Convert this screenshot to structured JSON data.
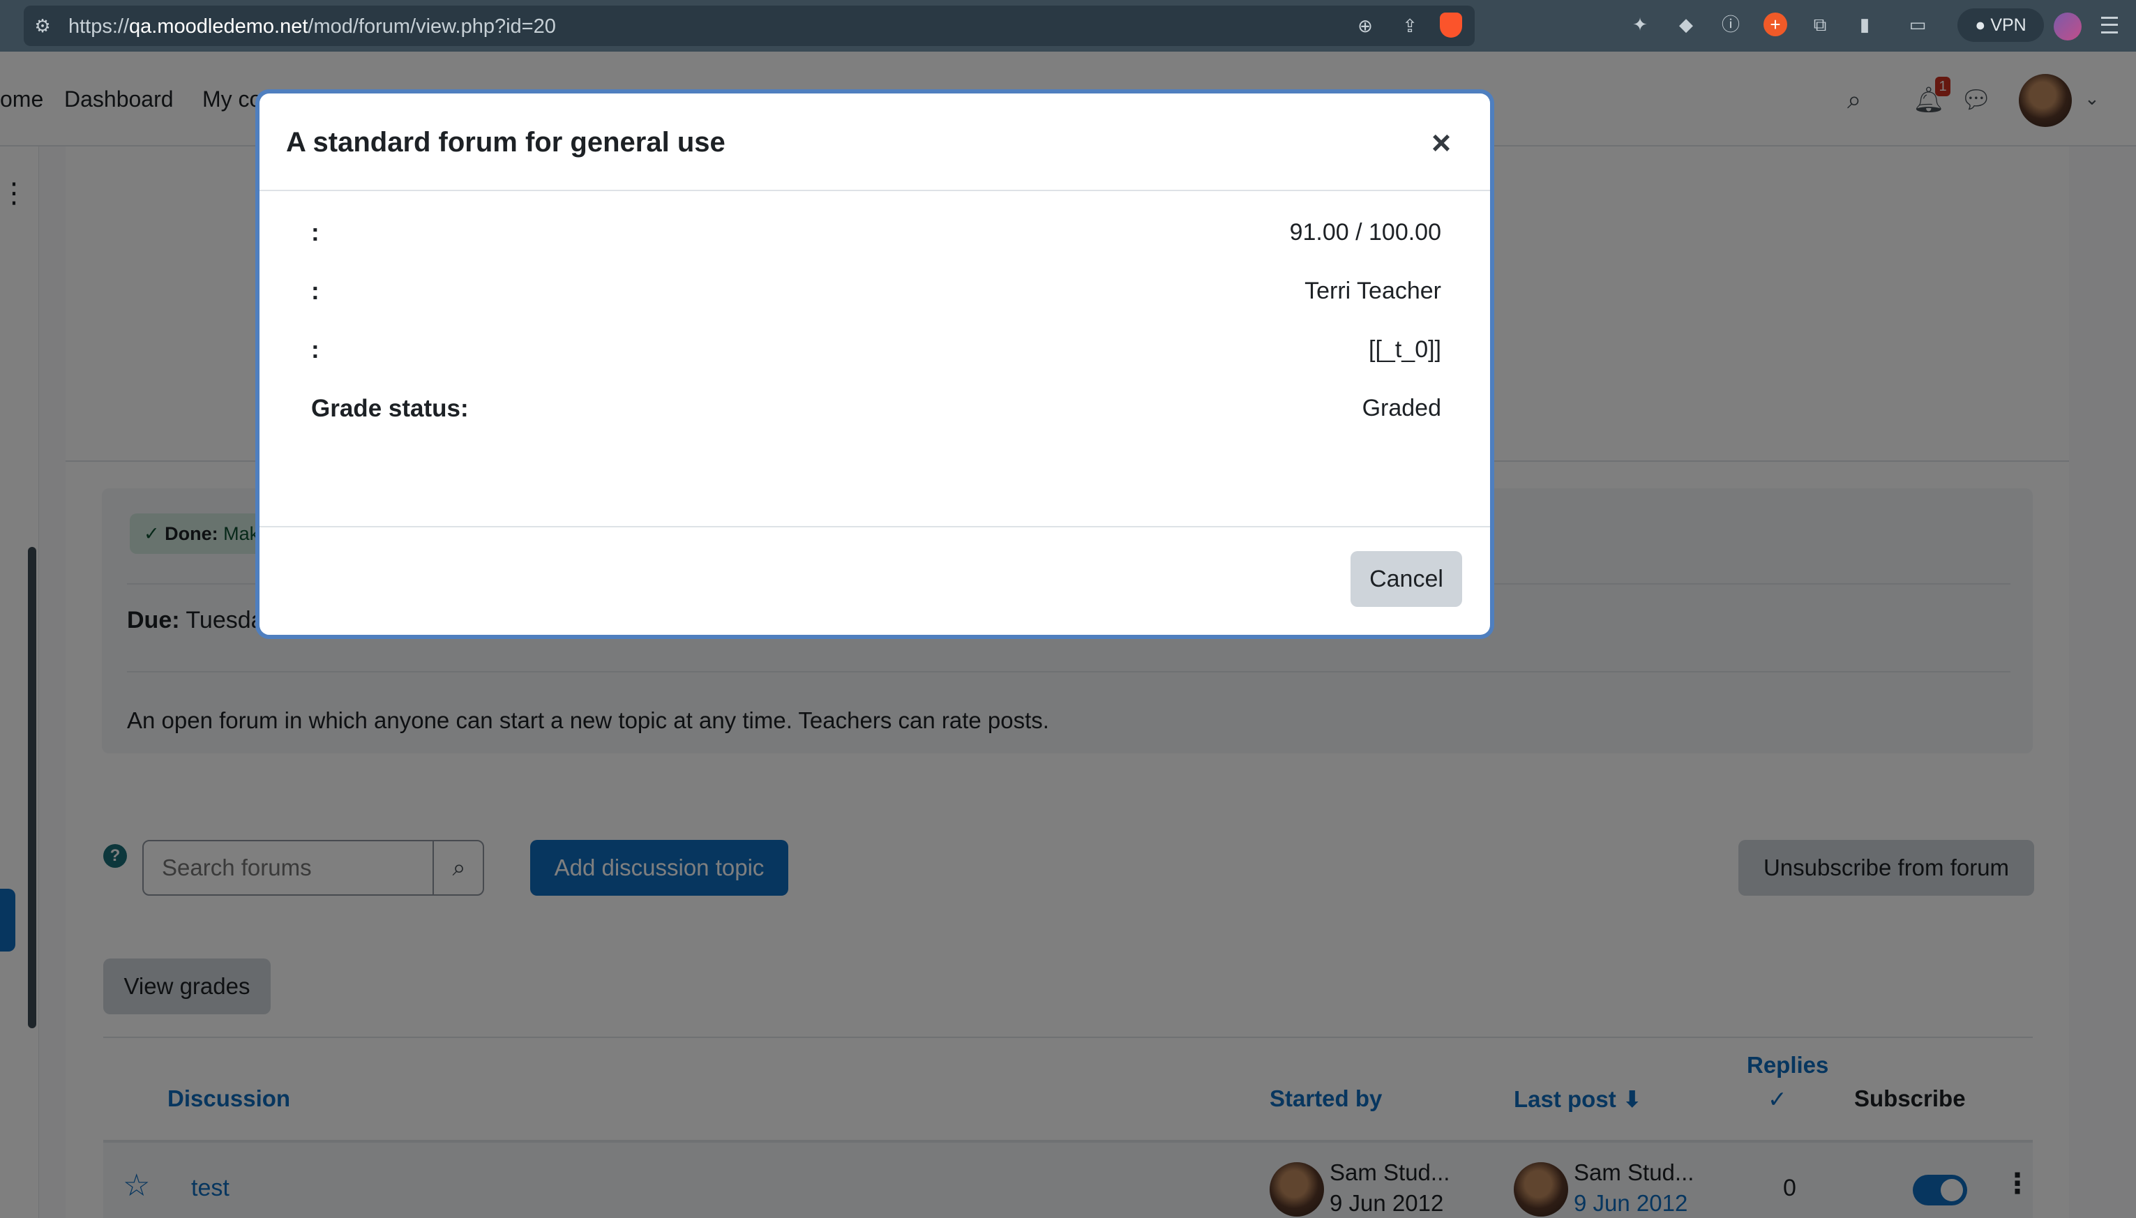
{
  "browser": {
    "url_host": "qa.moodledemo.net",
    "url_prefix": "https://",
    "url_path": "/mod/forum/view.php?id=20",
    "vpn_label": "VPN"
  },
  "navbar": {
    "home": "ome",
    "dashboard": "Dashboard",
    "my_courses": "My co",
    "theme": "THEME",
    "notification_count": "1"
  },
  "activity": {
    "done_prefix": "Done:",
    "done_text": "Mak",
    "due_label": "Due:",
    "due_value": "Tuesda",
    "description": "An open forum in which anyone can start a new topic at any time. Teachers can rate posts."
  },
  "controls": {
    "search_placeholder": "Search forums",
    "add_topic": "Add discussion topic",
    "unsubscribe": "Unsubscribe from forum",
    "view_grades": "View grades"
  },
  "table": {
    "headers": {
      "discussion": "Discussion",
      "started_by": "Started by",
      "last_post": "Last post",
      "replies": "Replies",
      "subscribe": "Subscribe"
    },
    "rows": [
      {
        "title": "test",
        "started_name": "Sam Stud...",
        "started_date": "9 Jun 2012",
        "last_name": "Sam Stud...",
        "last_date": "9 Jun 2012",
        "replies": "0"
      }
    ]
  },
  "modal": {
    "title": "A standard forum for general use",
    "details": [
      {
        "label": ":",
        "value": "91.00 / 100.00"
      },
      {
        "label": ":",
        "value": "Terri Teacher"
      },
      {
        "label": ":",
        "value": "[[_t_0]]"
      },
      {
        "label": "Grade status:",
        "value": "Graded"
      }
    ],
    "cancel": "Cancel"
  }
}
